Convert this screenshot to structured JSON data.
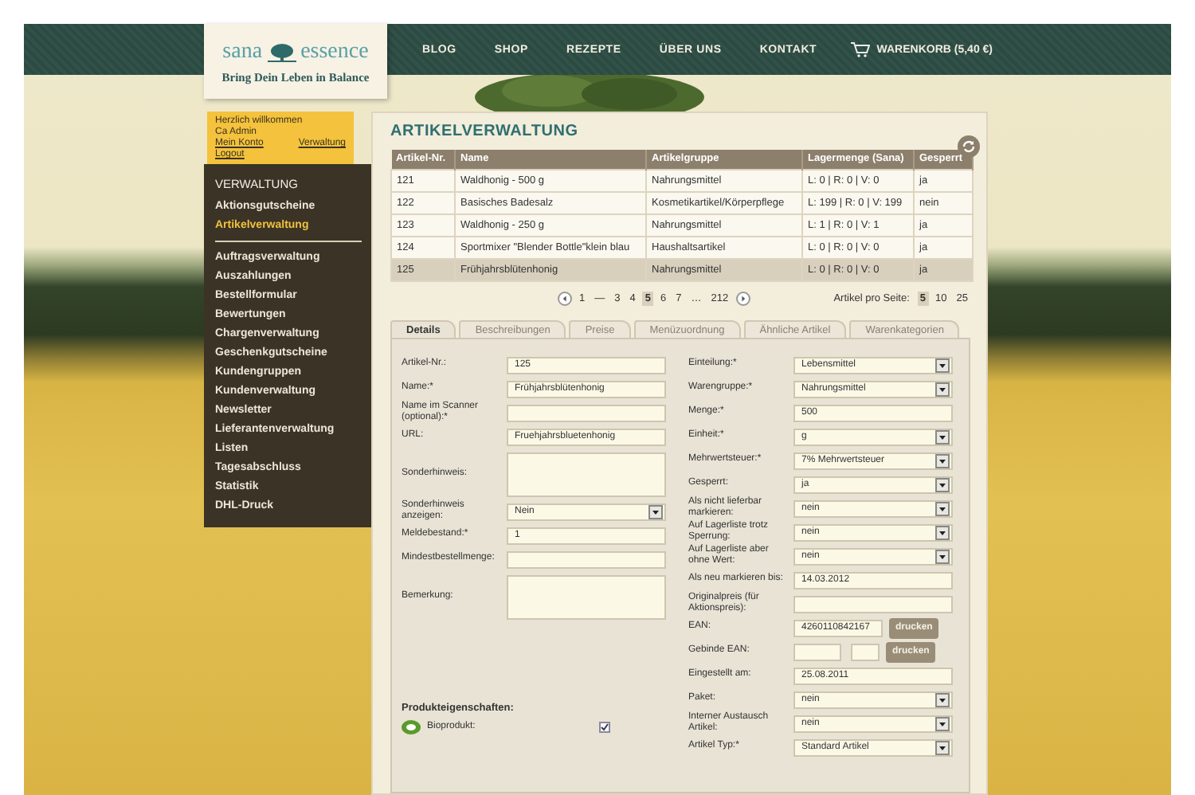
{
  "header": {
    "logo": {
      "name_left": "sana",
      "name_right": "essence",
      "tagline": "Bring Dein Leben in Balance"
    },
    "nav": [
      "BLOG",
      "SHOP",
      "REZEPTE",
      "ÜBER UNS",
      "KONTAKT"
    ],
    "cart": "WARENKORB (5,40 €)"
  },
  "welcome": {
    "greeting": "Herzlich willkommen",
    "user": "Ca Admin",
    "links": [
      "Mein Konto",
      "Verwaltung",
      "Logout"
    ]
  },
  "sidebar": {
    "heading": "VERWALTUNG",
    "items": [
      {
        "label": "Aktionsgutscheine",
        "selected": false
      },
      {
        "label": "Artikelverwaltung",
        "selected": true
      },
      {
        "label": "Auftragsverwaltung",
        "selected": false
      },
      {
        "label": "Auszahlungen",
        "selected": false
      },
      {
        "label": "Bestellformular",
        "selected": false
      },
      {
        "label": "Bewertungen",
        "selected": false
      },
      {
        "label": "Chargenverwaltung",
        "selected": false
      },
      {
        "label": "Geschenkgutscheine",
        "selected": false
      },
      {
        "label": "Kundengruppen",
        "selected": false
      },
      {
        "label": "Kundenverwaltung",
        "selected": false
      },
      {
        "label": "Newsletter",
        "selected": false
      },
      {
        "label": "Lieferantenverwaltung",
        "selected": false
      },
      {
        "label": "Listen",
        "selected": false
      },
      {
        "label": "Tagesabschluss",
        "selected": false
      },
      {
        "label": "Statistik",
        "selected": false
      },
      {
        "label": "DHL-Druck",
        "selected": false
      }
    ]
  },
  "page_title": "ARTIKELVERWALTUNG",
  "table": {
    "columns": [
      "Artikel-Nr.",
      "Name",
      "Artikelgruppe",
      "Lagermenge (Sana)",
      "Gesperrt"
    ],
    "rows": [
      {
        "cells": [
          "121",
          "Waldhonig - 500 g",
          "Nahrungsmittel",
          "L: 0 | R: 0 | V: 0",
          "ja"
        ],
        "selected": false
      },
      {
        "cells": [
          "122",
          "Basisches Badesalz",
          "Kosmetikartikel/Körperpflege",
          "L: 199 | R: 0 | V: 199",
          "nein"
        ],
        "selected": false
      },
      {
        "cells": [
          "123",
          "Waldhonig - 250 g",
          "Nahrungsmittel",
          "L: 1 | R: 0 | V: 1",
          "ja"
        ],
        "selected": false
      },
      {
        "cells": [
          "124",
          "Sportmixer \"Blender Bottle\"klein blau",
          "Haushaltsartikel",
          "L: 0 | R: 0 | V: 0",
          "ja"
        ],
        "selected": false
      },
      {
        "cells": [
          "125",
          "Frühjahrsblütenhonig",
          "Nahrungsmittel",
          "L: 0 | R: 0 | V: 0",
          "ja"
        ],
        "selected": true
      }
    ]
  },
  "pagination": {
    "pages": [
      {
        "label": "1",
        "selected": false
      },
      {
        "label": "—",
        "selected": false
      },
      {
        "label": "3",
        "selected": false
      },
      {
        "label": "4",
        "selected": false
      },
      {
        "label": "5",
        "selected": true
      },
      {
        "label": "6",
        "selected": false
      },
      {
        "label": "7",
        "selected": false
      },
      {
        "label": "…",
        "selected": false
      },
      {
        "label": "212",
        "selected": false
      }
    ],
    "per_page_label": "Artikel pro Seite:",
    "per_page": [
      {
        "label": "5",
        "selected": true
      },
      {
        "label": "10",
        "selected": false
      },
      {
        "label": "25",
        "selected": false
      }
    ]
  },
  "tabs": [
    {
      "label": "Details",
      "selected": true
    },
    {
      "label": "Beschreibungen",
      "selected": false
    },
    {
      "label": "Preise",
      "selected": false
    },
    {
      "label": "Menüzuordnung",
      "selected": false
    },
    {
      "label": "Ähnliche Artikel",
      "selected": false
    },
    {
      "label": "Warenkategorien",
      "selected": false
    }
  ],
  "form": {
    "left": [
      {
        "kind": "text",
        "label": "Artikel-Nr.:",
        "value": "125"
      },
      {
        "kind": "text",
        "label": "Name:*",
        "value": "Frühjahrsblütenhonig"
      },
      {
        "kind": "text",
        "label": "Name im Scanner (optional):*"
      },
      {
        "kind": "text",
        "label": "URL:",
        "value": "Fruehjahrsbluetenhonig"
      },
      {
        "kind": "textarea",
        "label": "Sonderhinweis:"
      },
      {
        "kind": "select",
        "label": "Sonderhinweis anzeigen:",
        "value": "Nein"
      },
      {
        "kind": "text",
        "label": "Meldebestand:*",
        "value": "1"
      },
      {
        "kind": "text",
        "label": "Mindestbestellmenge:"
      },
      {
        "kind": "textarea",
        "label": "Bemerkung:"
      }
    ],
    "right": [
      {
        "kind": "select",
        "label": "Einteilung:*",
        "value": "Lebensmittel"
      },
      {
        "kind": "select",
        "label": "Warengruppe:*",
        "value": "Nahrungsmittel"
      },
      {
        "kind": "text",
        "label": "Menge:*",
        "value": "500"
      },
      {
        "kind": "select",
        "label": "Einheit:*",
        "value": "g"
      },
      {
        "kind": "select",
        "label": "Mehrwertsteuer:*",
        "value": "7% Mehrwertsteuer"
      },
      {
        "kind": "select",
        "label": "Gesperrt:",
        "value": "ja"
      },
      {
        "kind": "select",
        "label": "Als nicht lieferbar markieren:",
        "value": "nein"
      },
      {
        "kind": "select",
        "label": "Auf Lagerliste trotz Sperrung:",
        "value": "nein"
      },
      {
        "kind": "select",
        "label": "Auf Lagerliste aber ohne Wert:",
        "value": "nein"
      },
      {
        "kind": "text",
        "label": "Als neu markieren bis:",
        "value": "14.03.2012"
      },
      {
        "kind": "text",
        "label": "Originalpreis (für Aktionspreis):"
      },
      {
        "kind": "print",
        "label": "EAN:",
        "value": "4260110842167",
        "button": "drucken"
      },
      {
        "kind": "print_dual",
        "label": "Gebinde EAN:",
        "button": "drucken"
      },
      {
        "kind": "text",
        "label": "Eingestellt am:",
        "value": "25.08.2011"
      },
      {
        "kind": "select",
        "label": "Paket:",
        "value": "nein"
      },
      {
        "kind": "select",
        "label": "Interner Austausch Artikel:",
        "value": "nein"
      },
      {
        "kind": "select",
        "label": "Artikel Typ:*",
        "value": "Standard Artikel"
      }
    ]
  },
  "properties": {
    "title": "Produkteigenschaften:",
    "items": [
      {
        "label": "Bioprodukt:",
        "checked": true
      }
    ]
  }
}
